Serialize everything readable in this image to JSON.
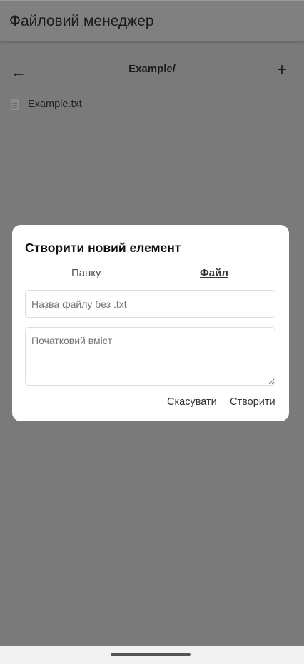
{
  "app": {
    "title": "Файловий менеджер"
  },
  "nav": {
    "back_icon": "←",
    "path": "Example/",
    "add_icon": "+"
  },
  "files": [
    {
      "name": "Example.txt",
      "icon": "file-icon"
    }
  ],
  "dialog": {
    "title": "Створити новий елемент",
    "tabs": [
      {
        "label": "Папку",
        "selected": false
      },
      {
        "label": "Файл",
        "selected": true
      }
    ],
    "name_input": {
      "value": "",
      "placeholder": "Назва файлу без .txt"
    },
    "content_input": {
      "value": "",
      "placeholder": "Початковий вміст"
    },
    "cancel_label": "Скасувати",
    "create_label": "Створити"
  }
}
